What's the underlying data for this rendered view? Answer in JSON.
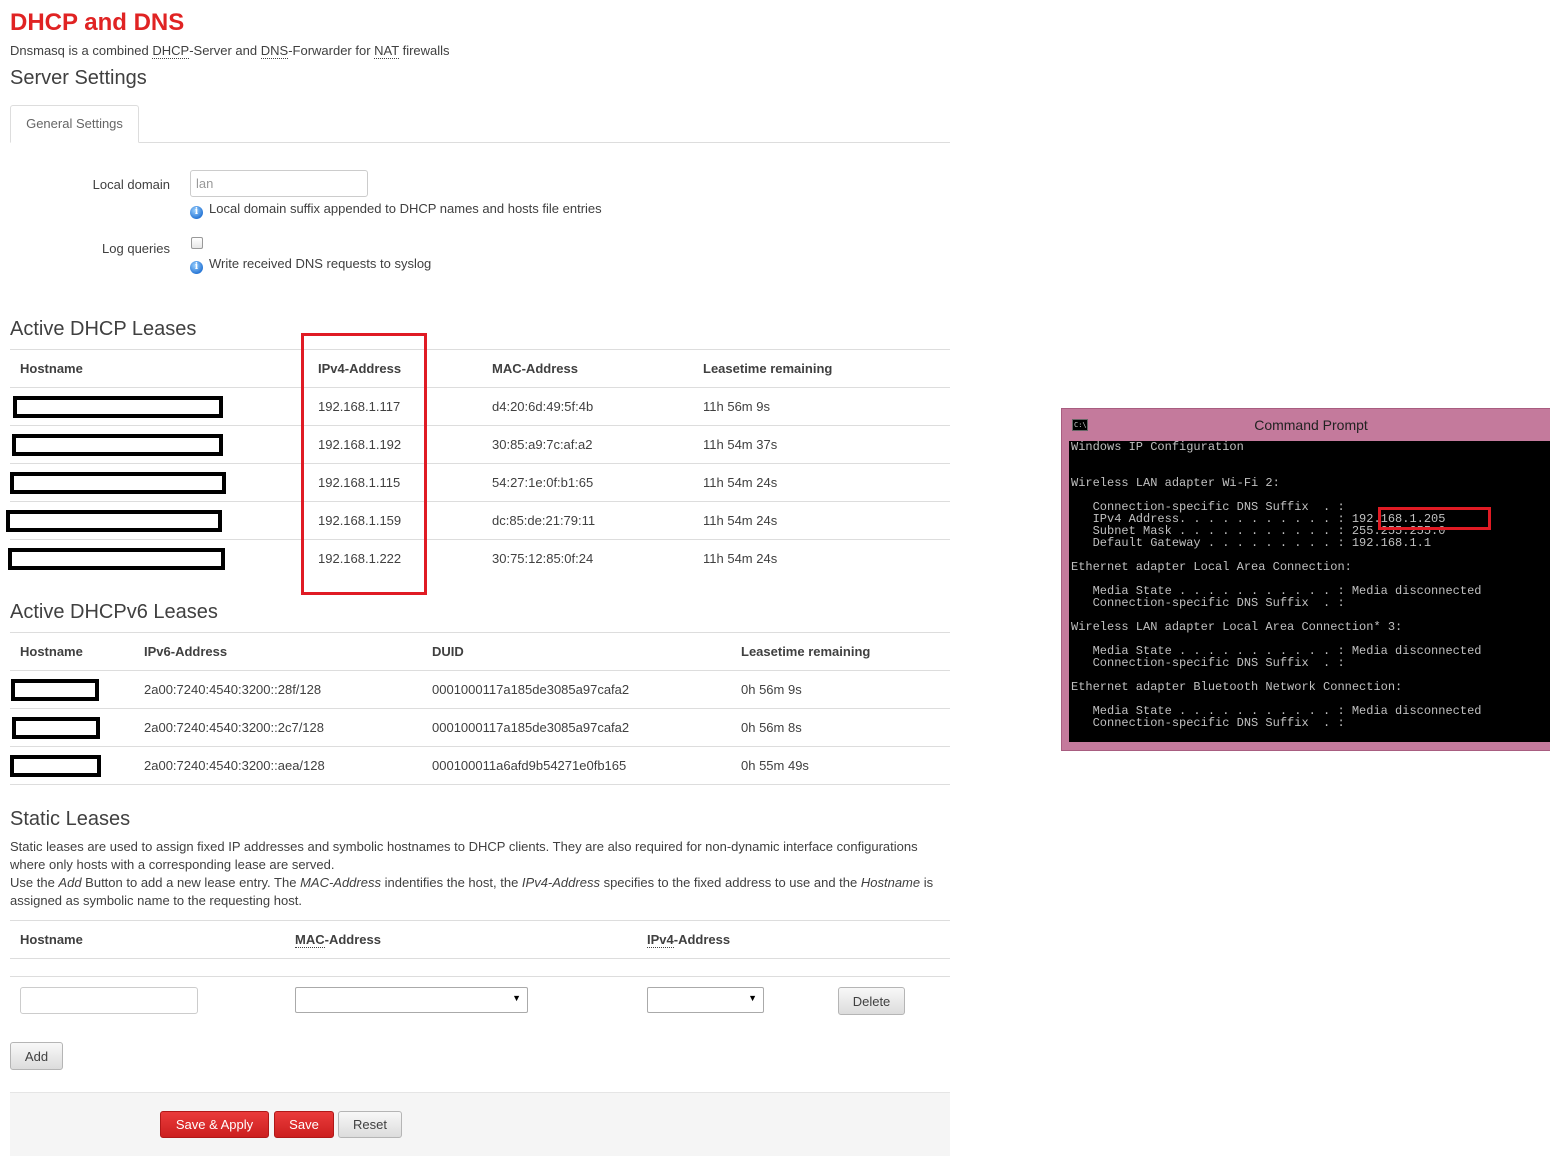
{
  "page": {
    "title": "DHCP and DNS",
    "desc_prefix": "Dnsmasq is a combined ",
    "desc_dhcp": "DHCP",
    "desc_mid1": "-Server and ",
    "desc_dns": "DNS",
    "desc_mid2": "-Forwarder for ",
    "desc_nat": "NAT",
    "desc_suffix": " firewalls"
  },
  "server_settings": {
    "title": "Server Settings",
    "tab_general": "General Settings",
    "local_domain_label": "Local domain",
    "local_domain_value": "lan",
    "local_domain_help": "Local domain suffix appended to DHCP names and hosts file entries",
    "log_queries_label": "Log queries",
    "log_queries_help": "Write received DNS requests to syslog"
  },
  "dhcp_leases": {
    "title": "Active DHCP Leases",
    "headers": [
      "Hostname",
      "IPv4-Address",
      "MAC-Address",
      "Leasetime remaining"
    ],
    "rows": [
      {
        "ip": "192.168.1.117",
        "mac": "d4:20:6d:49:5f:4b",
        "lease": "11h 56m 9s"
      },
      {
        "ip": "192.168.1.192",
        "mac": "30:85:a9:7c:af:a2",
        "lease": "11h 54m 37s"
      },
      {
        "ip": "192.168.1.115",
        "mac": "54:27:1e:0f:b1:65",
        "lease": "11h 54m 24s"
      },
      {
        "ip": "192.168.1.159",
        "mac": "dc:85:de:21:79:11",
        "lease": "11h 54m 24s"
      },
      {
        "ip": "192.168.1.222",
        "mac": "30:75:12:85:0f:24",
        "lease": "11h 54m 24s"
      }
    ]
  },
  "dhcpv6_leases": {
    "title": "Active DHCPv6 Leases",
    "headers": [
      "Hostname",
      "IPv6-Address",
      "DUID",
      "Leasetime remaining"
    ],
    "rows": [
      {
        "ip": "2a00:7240:4540:3200::28f/128",
        "duid": "0001000117a185de3085a97cafa2",
        "lease": "0h 56m 9s"
      },
      {
        "ip": "2a00:7240:4540:3200::2c7/128",
        "duid": "0001000117a185de3085a97cafa2",
        "lease": "0h 56m 8s"
      },
      {
        "ip": "2a00:7240:4540:3200::aea/128",
        "duid": "000100011a6afd9b54271e0fb165",
        "lease": "0h 55m 49s"
      }
    ]
  },
  "static_leases": {
    "title": "Static Leases",
    "desc1": "Static leases are used to assign fixed IP addresses and symbolic hostnames to DHCP clients. They are also required for non-dynamic interface configurations where only hosts with a corresponding lease are served.",
    "desc2_a": "Use the ",
    "desc2_add": "Add",
    "desc2_b": " Button to add a new lease entry. The ",
    "desc2_mac": "MAC-Address",
    "desc2_c": " indentifies the host, the ",
    "desc2_ipv4": "IPv4-Address",
    "desc2_d": " specifies to the fixed address to use and the ",
    "desc2_hostname": "Hostname",
    "desc2_e": " is assigned as symbolic name to the requesting host.",
    "header_hostname": "Hostname",
    "header_mac_abbr": "MAC",
    "header_mac_rest": "-Address",
    "header_ipv4_abbr": "IPv4",
    "header_ipv4_rest": "-Address",
    "delete_label": "Delete",
    "add_label": "Add"
  },
  "footer": {
    "save_apply": "Save & Apply",
    "save": "Save",
    "reset": "Reset"
  },
  "cmd": {
    "title": "Command Prompt",
    "icon_text": "C:\\",
    "lines": [
      "Windows IP Configuration",
      "",
      "",
      "Wireless LAN adapter Wi-Fi 2:",
      "",
      "   Connection-specific DNS Suffix  . :",
      "   IPv4 Address. . . . . . . . . . . : 192.168.1.205",
      "   Subnet Mask . . . . . . . . . . . : 255.255.255.0",
      "   Default Gateway . . . . . . . . . : 192.168.1.1",
      "",
      "Ethernet adapter Local Area Connection:",
      "",
      "   Media State . . . . . . . . . . . : Media disconnected",
      "   Connection-specific DNS Suffix  . :",
      "",
      "Wireless LAN adapter Local Area Connection* 3:",
      "",
      "   Media State . . . . . . . . . . . : Media disconnected",
      "   Connection-specific DNS Suffix  . :",
      "",
      "Ethernet adapter Bluetooth Network Connection:",
      "",
      "   Media State . . . . . . . . . . . : Media disconnected",
      "   Connection-specific DNS Suffix  . :"
    ]
  },
  "colors": {
    "brand_red": "#e02323",
    "highlight_red": "#e01b24",
    "cmd_frame": "#c47a9c"
  }
}
